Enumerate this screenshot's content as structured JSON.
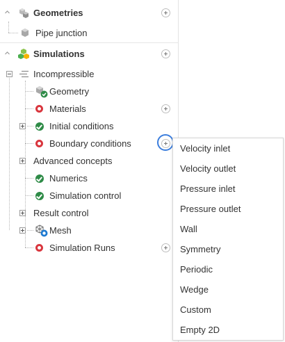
{
  "tree": {
    "geometries": {
      "label": "Geometries",
      "children": [
        {
          "label": "Pipe junction"
        }
      ]
    },
    "simulations": {
      "label": "Simulations",
      "incompressible": {
        "label": "Incompressible",
        "children": [
          {
            "label": "Geometry",
            "status": "complete"
          },
          {
            "label": "Materials",
            "status": "incomplete"
          },
          {
            "label": "Initial conditions",
            "status": "complete"
          },
          {
            "label": "Boundary conditions",
            "status": "incomplete"
          },
          {
            "label": "Advanced concepts"
          },
          {
            "label": "Numerics",
            "status": "complete"
          },
          {
            "label": "Simulation control",
            "status": "complete"
          },
          {
            "label": "Result control"
          },
          {
            "label": "Mesh"
          },
          {
            "label": "Simulation Runs",
            "status": "incomplete"
          }
        ]
      }
    }
  },
  "context_menu": {
    "items": [
      "Velocity inlet",
      "Velocity outlet",
      "Pressure inlet",
      "Pressure outlet",
      "Wall",
      "Symmetry",
      "Periodic",
      "Wedge",
      "Custom",
      "Empty 2D"
    ]
  },
  "colors": {
    "complete": "#2e8b47",
    "incomplete": "#d9363e",
    "focus": "#3b7ddd"
  }
}
